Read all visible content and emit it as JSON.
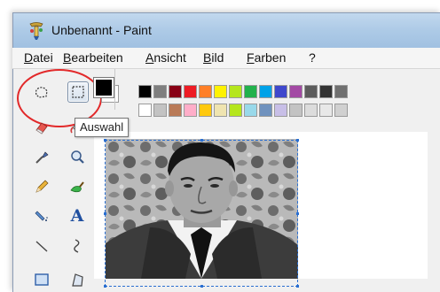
{
  "window": {
    "title": "Unbenannt - Paint",
    "app_icon": "paint-app-icon"
  },
  "menu": [
    {
      "label": "Datei",
      "mnemonic_index": 0
    },
    {
      "label": "Bearbeiten",
      "mnemonic_index": 0
    },
    {
      "label": "Ansicht",
      "mnemonic_index": 0
    },
    {
      "label": "Bild",
      "mnemonic_index": 0
    },
    {
      "label": "Farben",
      "mnemonic_index": 0
    },
    {
      "label": "?",
      "mnemonic_index": -1
    }
  ],
  "tools": [
    {
      "name": "free-form-select",
      "icon": "free-form-select-icon",
      "selected": false
    },
    {
      "name": "rectangle-select",
      "icon": "rectangle-select-icon",
      "selected": true
    },
    {
      "name": "eraser",
      "icon": "eraser-icon"
    },
    {
      "name": "fill",
      "icon": "fill-bucket-icon"
    },
    {
      "name": "pick-color",
      "icon": "eyedropper-icon"
    },
    {
      "name": "magnifier",
      "icon": "magnifier-icon"
    },
    {
      "name": "pencil",
      "icon": "pencil-icon"
    },
    {
      "name": "brush",
      "icon": "brush-icon"
    },
    {
      "name": "airbrush",
      "icon": "airbrush-icon"
    },
    {
      "name": "text",
      "icon": "text-tool-icon",
      "glyph": "A"
    },
    {
      "name": "line",
      "icon": "line-icon"
    },
    {
      "name": "curve",
      "icon": "curve-icon"
    },
    {
      "name": "rectangle",
      "icon": "rectangle-icon"
    },
    {
      "name": "polygon",
      "icon": "polygon-icon"
    }
  ],
  "tooltip": "Auswahl",
  "colors": {
    "foreground": "#000000",
    "background": "#ffffff",
    "selection_highlight": "#e2292a",
    "selection_border": "#2a6fd1",
    "palette_top": [
      "#000000",
      "#7f7f7f",
      "#880015",
      "#ed1c24",
      "#ff7f27",
      "#fff200",
      "#b5e61d",
      "#22b14c",
      "#00a2e8",
      "#3f48cc",
      "#a349a4",
      "#5c5c5c",
      "#333333",
      "#707070"
    ],
    "palette_bottom": [
      "#ffffff",
      "#c3c3c3",
      "#b97a57",
      "#ffaec9",
      "#ffc90e",
      "#efe4b0",
      "#b5e61d",
      "#99d9ea",
      "#7092be",
      "#c8bfe7",
      "#c3c3c3",
      "#dcdcdc",
      "#e8e8e8",
      "#d0d0d0"
    ]
  },
  "canvas": {
    "image": "black-and-white-portrait-photo"
  }
}
